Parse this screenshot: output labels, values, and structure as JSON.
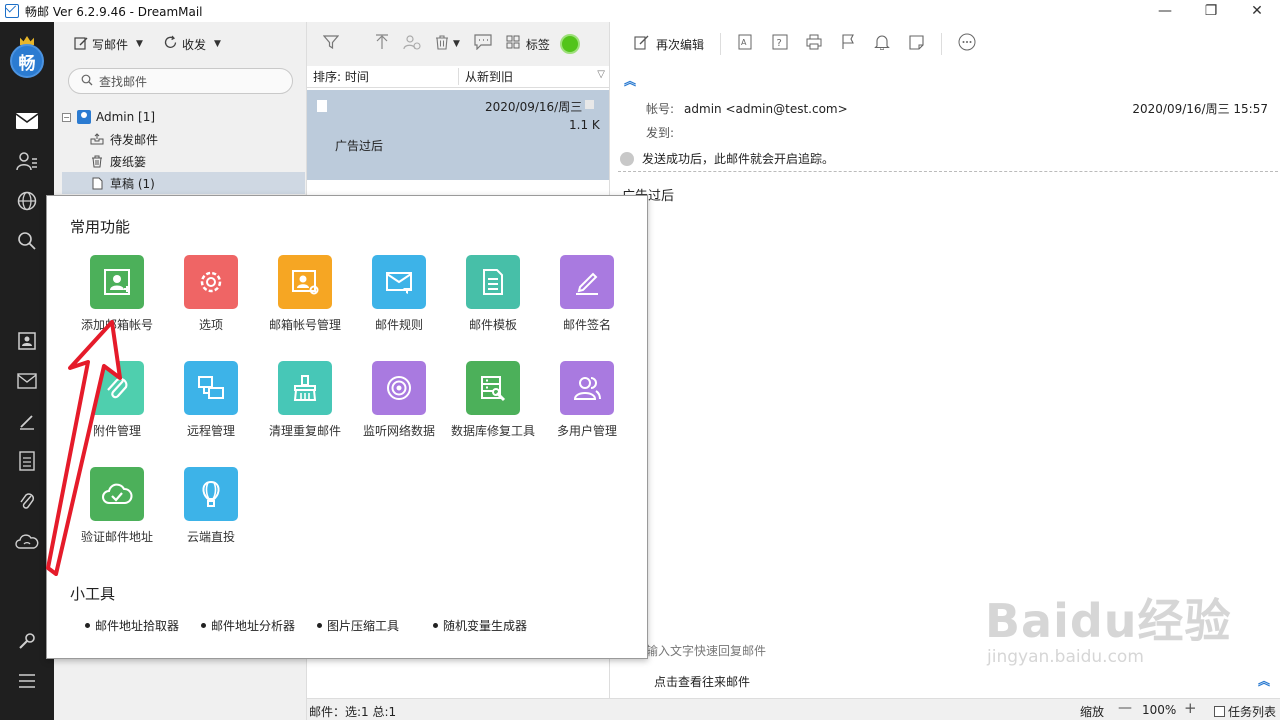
{
  "window": {
    "title": "畅邮 Ver 6.2.9.46  -  DreamMail",
    "minimize": "—",
    "maximize": "❐",
    "close": "✕"
  },
  "sidebar": {
    "logo_text": "畅"
  },
  "folder_toolbar": {
    "compose": "写邮件",
    "receive": "收发"
  },
  "search": {
    "placeholder": "查找邮件"
  },
  "folders": {
    "account": "Admin [1]",
    "items": [
      "待发邮件",
      "废纸篓",
      "草稿 (1)"
    ]
  },
  "list_toolbar": {
    "tag": "标签"
  },
  "sort": {
    "field": "排序: 时间",
    "order": "从新到旧"
  },
  "message": {
    "date": "2020/09/16/周三",
    "size": "1.1 K",
    "subject": "广告过后"
  },
  "list_status": "邮件：选:1 总:1",
  "read_toolbar": {
    "reedit": "再次编辑"
  },
  "read_header": {
    "account_label": "帐号:",
    "account_value": "admin <admin@test.com>",
    "date": "2020/09/16/周三 15:57",
    "to_label": "发到:",
    "notice": "发送成功后，此邮件就会开启追踪。",
    "body": "广告过后"
  },
  "reply_hint": "输入文字快速回复邮件",
  "view_history": "点击查看往来邮件",
  "zoom": {
    "label": "缩放",
    "minus": "—",
    "value": "100%",
    "plus": "+"
  },
  "task_list": "任务列表",
  "popup": {
    "common_title": "常用功能",
    "tiles": [
      {
        "label": "添加邮箱帐号",
        "color": "#4cb05a"
      },
      {
        "label": "选项",
        "color": "#ef6565"
      },
      {
        "label": "邮箱帐号管理",
        "color": "#f6a623"
      },
      {
        "label": "邮件规则",
        "color": "#3db3e8"
      },
      {
        "label": "邮件模板",
        "color": "#47bfa8"
      },
      {
        "label": "邮件签名",
        "color": "#a97ae0"
      },
      {
        "label": "附件管理",
        "color": "#4fcfae"
      },
      {
        "label": "远程管理",
        "color": "#3db3e8"
      },
      {
        "label": "清理重复邮件",
        "color": "#47c7b7"
      },
      {
        "label": "监听网络数据",
        "color": "#a97ae0"
      },
      {
        "label": "数据库修复工具",
        "color": "#4cb05a"
      },
      {
        "label": "多用户管理",
        "color": "#a97ae0"
      },
      {
        "label": "验证邮件地址",
        "color": "#4cb05a"
      },
      {
        "label": "云端直投",
        "color": "#3db3e8"
      }
    ],
    "tools_title": "小工具",
    "tools": [
      "邮件地址拾取器",
      "邮件地址分析器",
      "图片压缩工具",
      "随机变量生成器"
    ]
  },
  "watermark": {
    "brand": "Baidu经验",
    "url": "jingyan.baidu.com"
  }
}
